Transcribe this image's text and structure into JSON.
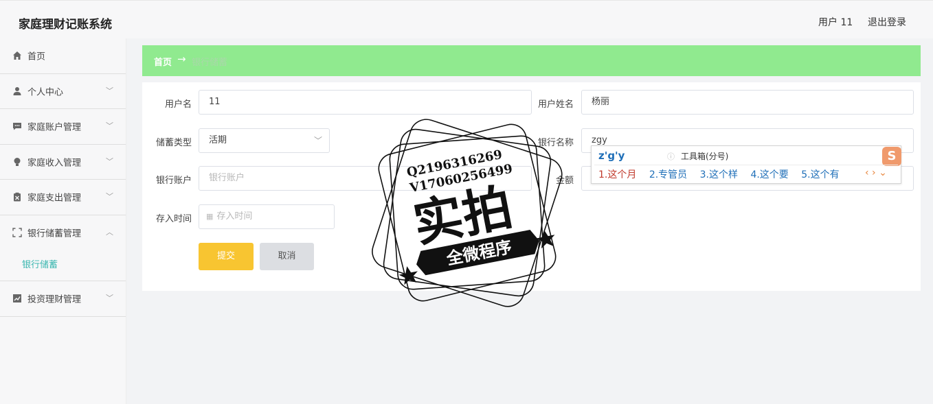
{
  "header": {
    "title": "家庭理财记账系统",
    "user_label": "用户 11",
    "logout_label": "退出登录"
  },
  "sidebar": {
    "items": [
      {
        "label": "首页",
        "icon": "home-icon",
        "has_chevron": false
      },
      {
        "label": "个人中心",
        "icon": "person-icon",
        "has_chevron": true
      },
      {
        "label": "家庭账户管理",
        "icon": "chat-icon",
        "has_chevron": true
      },
      {
        "label": "家庭收入管理",
        "icon": "bulb-icon",
        "has_chevron": true
      },
      {
        "label": "家庭支出管理",
        "icon": "clipboard-icon",
        "has_chevron": true
      },
      {
        "label": "银行储蓄管理",
        "icon": "fullscreen-icon",
        "has_chevron": true,
        "expanded": true,
        "children": [
          {
            "label": "银行储蓄",
            "active": true
          }
        ]
      },
      {
        "label": "投资理财管理",
        "icon": "chart-icon",
        "has_chevron": true
      }
    ]
  },
  "breadcrumb": {
    "home": "首页",
    "separator": "→",
    "current": "银行储蓄"
  },
  "form": {
    "username": {
      "label": "用户名",
      "value": "11"
    },
    "realname": {
      "label": "用户姓名",
      "value": "杨丽"
    },
    "deposit_type": {
      "label": "储蓄类型",
      "value": "活期"
    },
    "bank_name": {
      "label": "银行名称",
      "value": "zgy"
    },
    "bank_account": {
      "label": "银行账户",
      "placeholder": "银行账户"
    },
    "amount": {
      "label": "金额",
      "value": ""
    },
    "deposit_time": {
      "label": "存入时间",
      "placeholder": "存入时间"
    },
    "submit_label": "提交",
    "cancel_label": "取消"
  },
  "ime": {
    "composition": "z'g'y",
    "toolbox": "工具箱(分号)",
    "candidates": [
      "1.这个月",
      "2.专管员",
      "3.这个样",
      "4.这个要",
      "5.这个有"
    ],
    "nav": "‹ › ⌄",
    "logo": "S"
  },
  "watermark": {
    "line1": "Q2196316269",
    "line2": "V17060256499",
    "main": "实拍",
    "banner": "全微程序"
  },
  "colors": {
    "breadcrumb_bg": "#90ea8f",
    "submit_bg": "#f8c531",
    "active_sub": "#3bb7b0"
  }
}
